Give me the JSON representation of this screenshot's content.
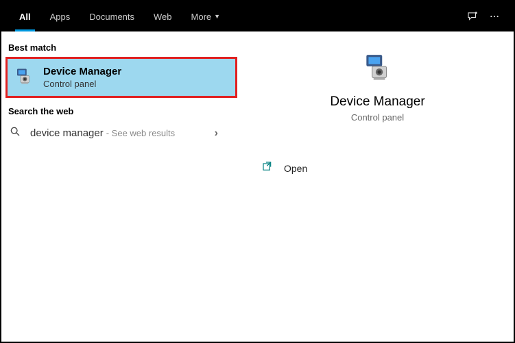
{
  "tabs": {
    "all": "All",
    "apps": "Apps",
    "documents": "Documents",
    "web": "Web",
    "more": "More"
  },
  "sections": {
    "best_match": "Best match",
    "search_web": "Search the web"
  },
  "result": {
    "title": "Device Manager",
    "subtitle": "Control panel"
  },
  "web": {
    "query": "device manager",
    "hint": "- See web results"
  },
  "detail": {
    "title": "Device Manager",
    "subtitle": "Control panel"
  },
  "actions": {
    "open": "Open"
  }
}
